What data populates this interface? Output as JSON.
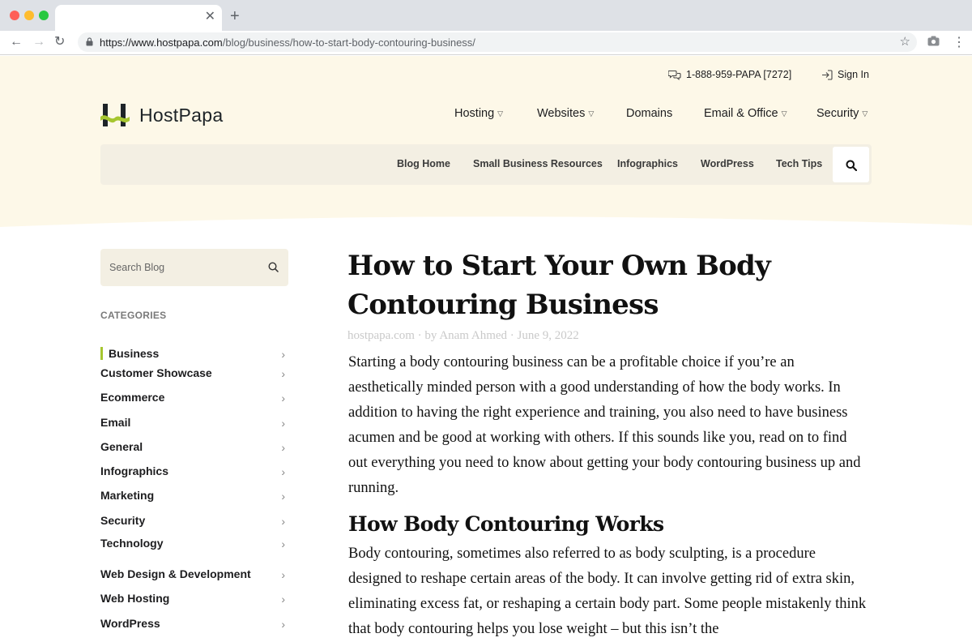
{
  "browser": {
    "url_host": "https://www.hostpapa.com",
    "url_path": "/blog/business/how-to-start-body-contouring-business/",
    "tab_close": "✕",
    "new_tab": "+"
  },
  "topbar": {
    "phone": "1-888-959-PAPA [7272]",
    "signin": "Sign In"
  },
  "logo": {
    "text": "HostPapa"
  },
  "mainnav": {
    "hosting": "Hosting",
    "websites": "Websites",
    "domains": "Domains",
    "email": "Email & Office",
    "security": "Security"
  },
  "subnav": {
    "blog_home": "Blog Home",
    "resources": "Small Business Resources",
    "infographics": "Infographics",
    "wordpress": "WordPress",
    "tech_tips": "Tech Tips"
  },
  "sidebar": {
    "search_placeholder": "Search Blog",
    "categories_title": "CATEGORIES",
    "categories": [
      "Business",
      "Customer Showcase",
      "Ecommerce",
      "Email",
      "General",
      "Infographics",
      "Marketing",
      "Security",
      "Technology",
      "Web Design & Development",
      "Web Hosting",
      "WordPress"
    ],
    "active_category": "Business"
  },
  "article": {
    "title": "How to Start Your Own Body Contouring Business",
    "meta": "hostpapa.com · by Anam Ahmed · June 9, 2022",
    "intro": "Starting a body contouring business can be a profitable choice if you’re an aesthetically minded person with a good understanding of how the body works. In addition to having the right experience and training, you also need to have business acumen and be good at working with others. If this sounds like you, read on to find out everything you need to know about getting your body contouring business up and running.",
    "h2": "How Body Contouring Works",
    "body": "Body contouring, sometimes also referred to as body sculpting, is a procedure designed to reshape certain areas of the body. It can involve getting rid of extra skin, eliminating excess fat, or reshaping a certain body part. Some people mistakenly think that body contouring helps you lose weight – but this isn’t the"
  },
  "colors": {
    "header_bg": "#fdf8e8",
    "subnav_bg": "#f3efe3",
    "accent": "#a6c630"
  }
}
